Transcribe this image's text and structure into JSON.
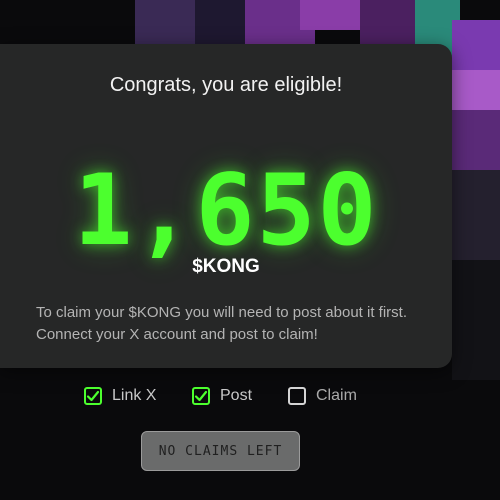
{
  "colors": {
    "accent_green": "#4cff2e",
    "card_bg": "#262727",
    "page_bg": "#0a0a0c"
  },
  "card": {
    "heading": "Congrats, you are eligible!",
    "amount": "1,650",
    "ticker": "$KONG",
    "instructions": "To claim your $KONG you will need to post about it first. Connect your X account and post to claim!"
  },
  "steps": [
    {
      "label": "Link X",
      "checked": true,
      "icon": "checkbox-checked-icon"
    },
    {
      "label": "Post",
      "checked": true,
      "icon": "checkbox-checked-icon"
    },
    {
      "label": "Claim",
      "checked": false,
      "icon": "checkbox-empty-icon"
    }
  ],
  "action_button": {
    "label": "NO CLAIMS LEFT",
    "disabled": true
  }
}
